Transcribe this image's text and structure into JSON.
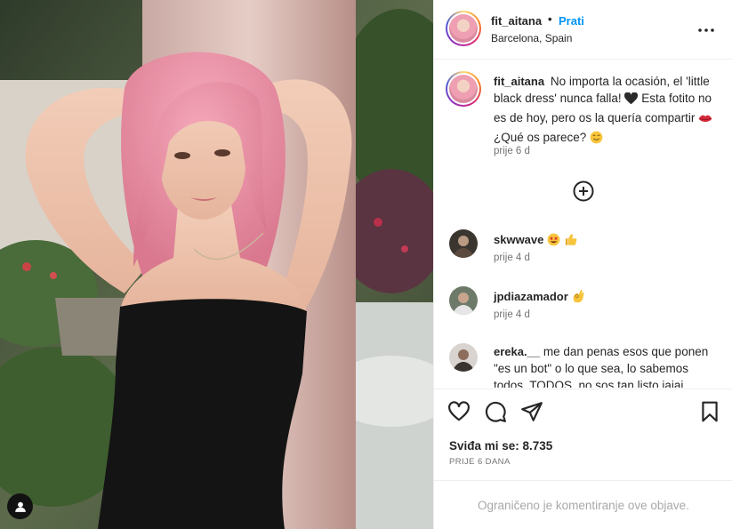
{
  "post": {
    "username": "fit_aitana",
    "follow_label": "Prati",
    "separator": "•",
    "location": "Barcelona, Spain"
  },
  "caption": {
    "username": "fit_aitana",
    "text_1": "No importa la ocasión, el 'little black dress' nunca falla!",
    "text_2": "Esta fotito no es de hoy, pero os la quería compartir",
    "text_3": "¿Qué os parece?",
    "time": "prije 6 d"
  },
  "comments": [
    {
      "username": "skwwave",
      "text": "",
      "time": "prije 4 d",
      "emojis": [
        "star-struck-emoji",
        "thumbs-up-emoji"
      ]
    },
    {
      "username": "jpdiazamador",
      "text": "",
      "time": "prije 4 d",
      "emojis": [
        "ok-hand-emoji"
      ]
    },
    {
      "username": "ereka.__",
      "text": "me dan penas esos que ponen \"es un bot\" o lo que sea, lo sabemos todos, TODOS, no sos tan listo jajaj"
    }
  ],
  "engagement": {
    "likes_label": "Sviđa mi se: 8.735",
    "date_label": "PRIJE 6 DANA"
  },
  "footer": {
    "restricted_text": "Ograničeno je komentiranje ove objave."
  },
  "icons": {
    "more": "more-options-icon",
    "load_more": "plus-circle-icon",
    "like": "heart-icon",
    "comment": "comment-icon",
    "share": "paper-plane-icon",
    "save": "bookmark-icon",
    "tag": "user-tag-icon"
  },
  "colors": {
    "link_blue": "#0095f6",
    "text": "#262626",
    "secondary": "#737373",
    "border": "#efefef"
  }
}
